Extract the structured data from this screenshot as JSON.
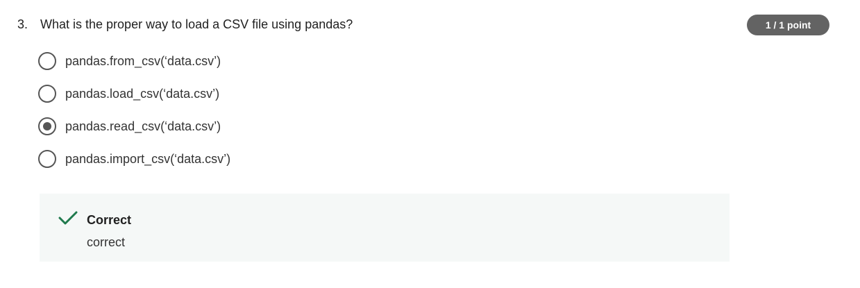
{
  "question": {
    "number": "3.",
    "text": "What is the proper way to load a CSV file using pandas?",
    "score": "1 / 1 point"
  },
  "options": [
    {
      "label": "pandas.from_csv(‘data.csv’)",
      "selected": false
    },
    {
      "label": "pandas.load_csv(‘data.csv’)",
      "selected": false
    },
    {
      "label": "pandas.read_csv(‘data.csv’)",
      "selected": true
    },
    {
      "label": "pandas.import_csv(‘data.csv’)",
      "selected": false
    }
  ],
  "feedback": {
    "icon": "check-icon",
    "title": "Correct",
    "text": "correct"
  },
  "colors": {
    "badge_bg": "#636363",
    "radio": "#555555",
    "check": "#1f7a4d",
    "feedback_bg": "#f5f8f7"
  }
}
